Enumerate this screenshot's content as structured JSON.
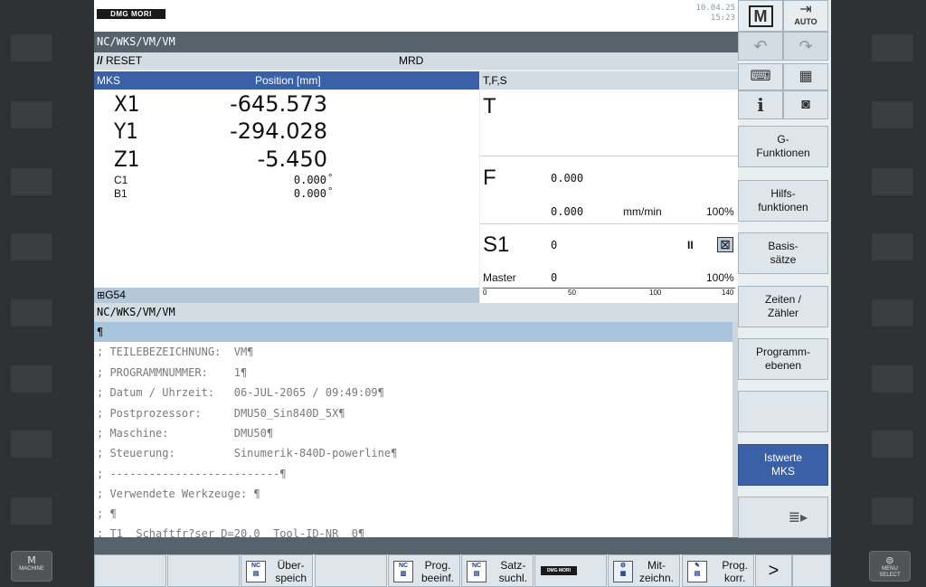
{
  "header": {
    "brand": "DMG MORI",
    "date": "10.04.25",
    "time": "15:23",
    "program_path": "NC/WKS/VM/VM",
    "reset_label": "RESET",
    "mode_label": "MRD"
  },
  "top_right": {
    "machine_label": "M",
    "auto_label": "AUTO"
  },
  "positions": {
    "header_left": "MKS",
    "header_right": "Position [mm]",
    "main_axes": [
      {
        "axis": "X1",
        "value": "-645.573"
      },
      {
        "axis": "Y1",
        "value": "-294.028"
      },
      {
        "axis": "Z1",
        "value": "-5.450"
      }
    ],
    "rotary_axes": [
      {
        "axis": "C1",
        "value": "0.000",
        "unit": "°"
      },
      {
        "axis": "B1",
        "value": "0.000",
        "unit": "°"
      }
    ],
    "work_offset": "G54"
  },
  "tfs": {
    "header": "T,F,S",
    "tool_label": "T",
    "feed_label": "F",
    "feed_value": "0.000",
    "feed_actual": "0.000",
    "feed_unit": "mm/min",
    "feed_override": "100%",
    "spindle_label": "S1",
    "spindle_value": "0",
    "spindle_state": "II",
    "spindle_stop_icon": "⊠",
    "master_label": "Master",
    "master_value": "0",
    "spindle_override": "100%",
    "scale_ticks": [
      "0",
      "50",
      "100",
      "140"
    ]
  },
  "program": {
    "path": "NC/WKS/VM/VM",
    "lines": [
      "¶",
      "; TEILEBEZEICHNUNG:  VM¶",
      "; PROGRAMMNUMMER:    1¶",
      "; Datum / Uhrzeit:   06-JUL-2065 / 09:49:09¶",
      "; Postprozessor:     DMU50_Sin840D_5X¶",
      "; Maschine:          DMU50¶",
      "; Steuerung:         Sinumerik-840D-powerline¶",
      "; --------------------------¶",
      "; Verwendete Werkzeuge: ¶",
      "; ¶",
      "; T1  Schaftfr?ser D=20.0  Tool-ID-NR  0¶"
    ]
  },
  "vertical_softkeys": [
    {
      "label": "G-\nFunktionen",
      "active": false
    },
    {
      "label": "Hilfs-\nfunktionen",
      "active": false
    },
    {
      "label": "Basis-\nsätze",
      "active": false
    },
    {
      "label": "Zeiten /\nZähler",
      "active": false
    },
    {
      "label": "Programm-\nebenen",
      "active": false
    },
    {
      "label": "",
      "active": false
    },
    {
      "label": "Istwerte\nMKS",
      "active": true
    },
    {
      "label": "",
      "active": false
    }
  ],
  "horizontal_softkeys": {
    "ueberspeich": "Über-\nspeich",
    "prog_beeinf": "Prog.\nbeeinf.",
    "satzsuchl": "Satz-\nsuchl.",
    "mitzeichn": "Mit-\nzeichn.",
    "prog_korr": "Prog.\nkorr.",
    "more": ">"
  },
  "bezel": {
    "machine_key": "MACHINE",
    "menu_select_key": "MENU\nSELECT"
  }
}
